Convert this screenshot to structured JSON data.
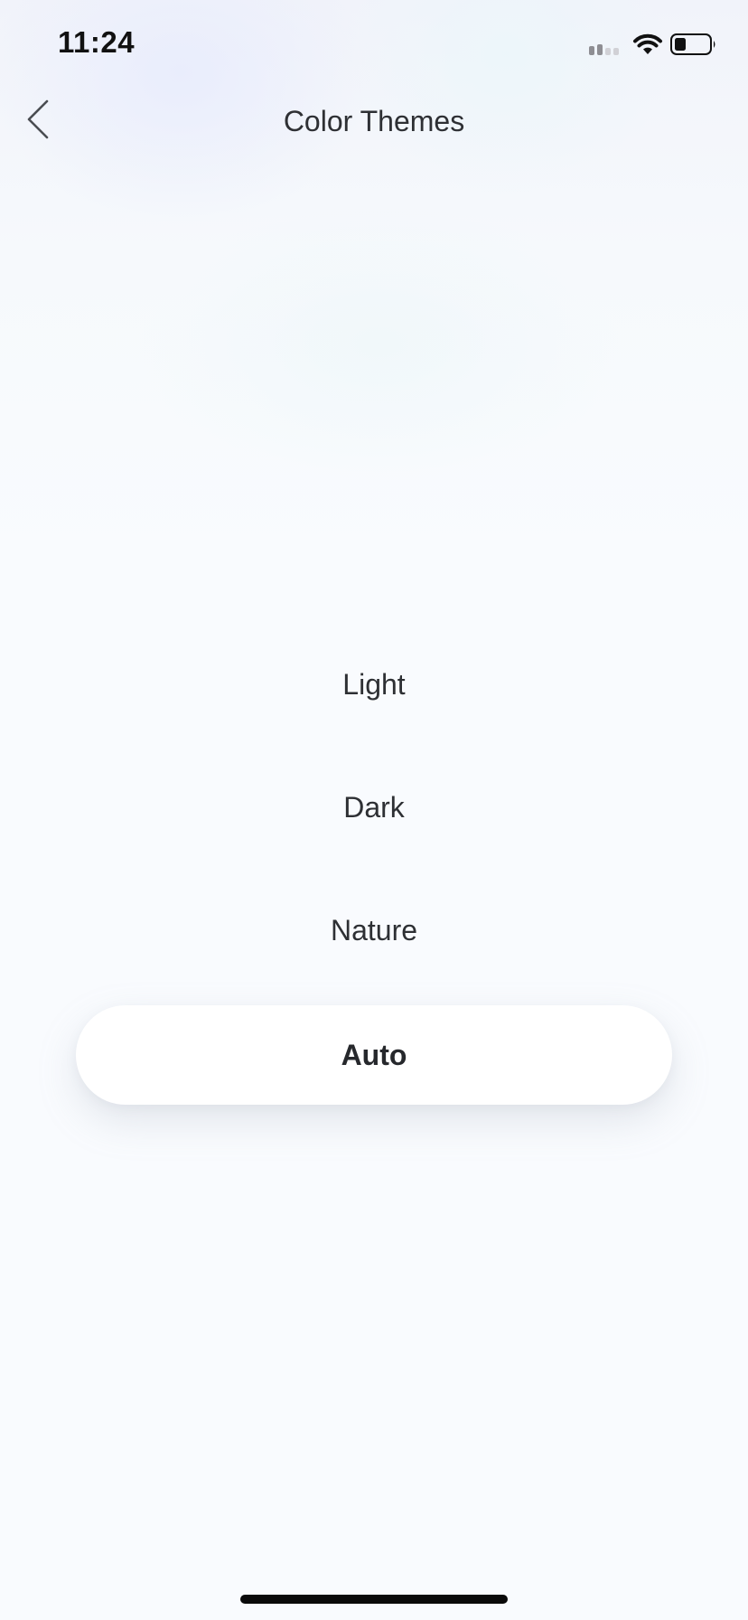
{
  "status_bar": {
    "time": "11:24"
  },
  "header": {
    "title": "Color Themes",
    "back_icon": "chevron-left-icon"
  },
  "themes": [
    {
      "label": "Light",
      "selected": false
    },
    {
      "label": "Dark",
      "selected": false
    },
    {
      "label": "Nature",
      "selected": false
    },
    {
      "label": "Auto",
      "selected": true
    }
  ],
  "colors": {
    "background": "#f9fbfe",
    "text": "#2e3034",
    "selected_pill": "#ffffff"
  }
}
